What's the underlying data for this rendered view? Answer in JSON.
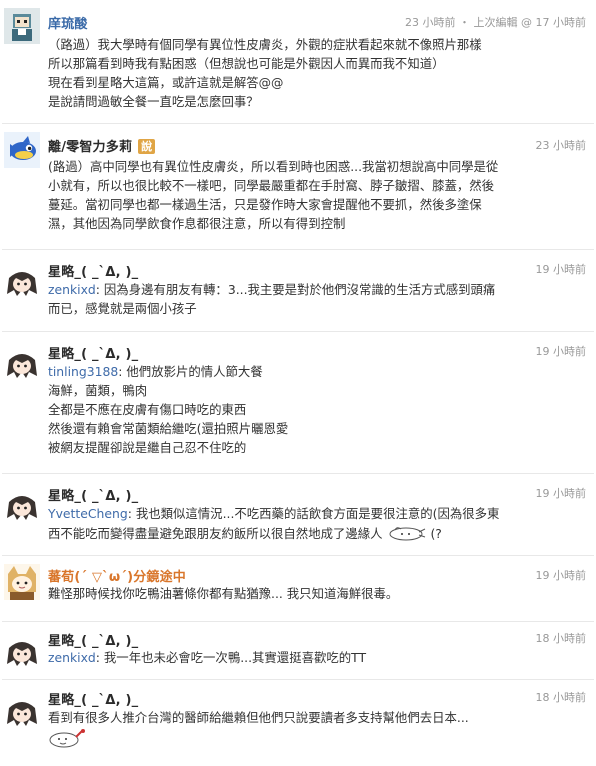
{
  "posts": [
    {
      "user": "庠琉酸",
      "meta": "23 小時前 ・ 上次編輯 @ 17 小時前",
      "lines": [
        "（路過）我大學時有個同學有異位性皮膚炎，外觀的症狀看起來就不像照片那樣",
        "所以那篇看到時我有點困惑（但想說也可能是外觀因人而異而我不知道）",
        "現在看到星略大這篇，或許這就是解答@@",
        "是說請問過敏全餐一直吃是怎麼回事？"
      ]
    },
    {
      "user": "離/零智力多莉",
      "tag": "說",
      "meta": "23 小時前",
      "lines": [
        "(路過）高中同學也有異位性皮膚炎，所以看到時也困惑...我當初想說高中同學是從",
        "小就有，所以也很比較不一樣吧，同學最嚴重都在手肘窩、脖子皺摺、膝蓋，然後",
        "蔓延。當初同學也都一樣過生活，只是發作時大家會提醒他不要抓，然後多塗保",
        "濕，其他因為同學飲食作息都很注意，所以有得到控制"
      ]
    },
    {
      "user": "星略_( _`Δ, )_",
      "meta": "19 小時前",
      "mention": "zenkixd",
      "first": ": 因為身邊有朋友有轉：3...我主要是對於他們沒常識的生活方式感到頭痛",
      "lines": [
        "而已，感覺就是兩個小孩子"
      ]
    },
    {
      "user": "星略_( _`Δ, )_",
      "meta": "19 小時前",
      "mention": "tinling3188",
      "first": ": 他們放影片的情人節大餐",
      "lines": [
        "海鮮，菌類，鴨肉",
        "全都是不應在皮膚有傷口時吃的東西",
        "然後還有賴會常菌類給繼吃(還拍照片曬恩愛",
        "被網友提醒卻說是繼自己忍不住吃的"
      ]
    },
    {
      "user": "星略_( _`Δ, )_",
      "meta": "19 小時前",
      "mention": "YvetteCheng",
      "first": ": 我也類似這情況...不吃西藥的話飲食方面是要很注意的(因為很多東",
      "lines": [
        "西不能吃而變得盡量避免跟朋友約飯所以很自然地成了邊緣人"
      ],
      "tail": " (?"
    },
    {
      "user": "蕃荀(´ ▽`ω´)分鏡途中",
      "meta": "19 小時前",
      "lines": [
        "難怪那時候找你吃鴨油薯條你都有點猶豫... 我只知道海鮮很毒。"
      ]
    },
    {
      "user": "星略_( _`Δ, )_",
      "meta": "18 小時前",
      "mention": "zenkixd",
      "first": ": 我一年也未必會吃一次鴨...其實還挺喜歡吃的TT",
      "lines": []
    },
    {
      "user": "星略_( _`Δ, )_",
      "meta": "18 小時前",
      "lines": [
        "看到有很多人推介台灣的醫師給繼賴但他們只說要讀者多支持幫他們去日本..."
      ]
    }
  ],
  "colors": {
    "link": "#3f6ba9",
    "meta": "#999999",
    "tag": "#e0a545",
    "orange_name": "#d9762b"
  }
}
